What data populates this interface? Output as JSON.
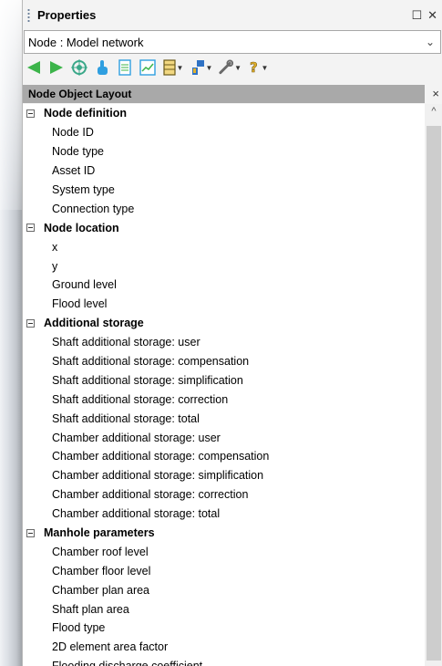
{
  "panel": {
    "title": "Properties"
  },
  "title_buttons": {
    "float": "☐",
    "close": "✕"
  },
  "selector": {
    "value": "Node : Model network",
    "chevron": "⌄"
  },
  "toolbar": {
    "icons": [
      "back-arrow-icon",
      "forward-arrow-icon",
      "target-icon",
      "pointer-hand-icon",
      "document-icon",
      "chart-icon",
      "grid-dropdown-icon",
      "paint-dropdown-icon",
      "tools-dropdown-icon",
      "help-dropdown-icon"
    ],
    "colors": {
      "nav_green": "#3cb44a",
      "accent_blue": "#2f72c4",
      "yellow": "#e3b12a"
    }
  },
  "layout_header": {
    "label": "Node Object Layout",
    "close": "×"
  },
  "scroll": {
    "up": "^"
  },
  "tree": {
    "groups": [
      {
        "label": "Node definition",
        "items": [
          "Node ID",
          "Node type",
          "Asset ID",
          "System type",
          "Connection type"
        ]
      },
      {
        "label": "Node location",
        "items": [
          "x",
          "y",
          "Ground level",
          "Flood level"
        ]
      },
      {
        "label": "Additional storage",
        "items": [
          "Shaft additional storage: user",
          "Shaft additional storage: compensation",
          "Shaft additional storage: simplification",
          "Shaft additional storage: correction",
          "Shaft additional storage: total",
          "Chamber additional storage: user",
          "Chamber additional storage: compensation",
          "Chamber additional storage: simplification",
          "Chamber additional storage: correction",
          "Chamber additional storage: total"
        ]
      },
      {
        "label": "Manhole parameters",
        "items": [
          "Chamber roof level",
          "Chamber floor level",
          "Chamber plan area",
          "Shaft plan area",
          "Flood type",
          "2D element area factor",
          "Flooding discharge coefficient"
        ]
      }
    ]
  }
}
